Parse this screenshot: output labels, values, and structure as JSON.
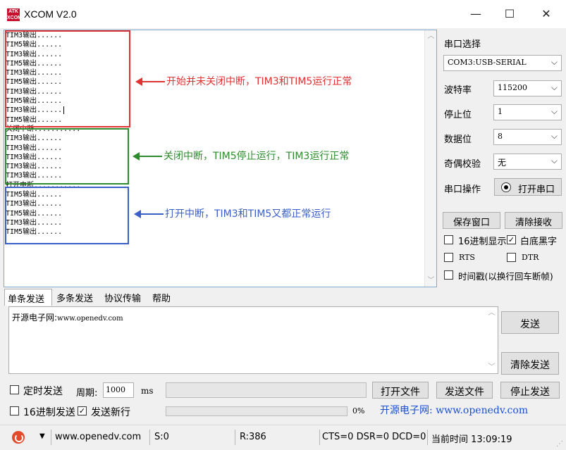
{
  "window": {
    "title": "XCOM V2.0",
    "logo_text": "ATK XCOM",
    "minimize_glyph": "—",
    "maximize_glyph": "☐",
    "close_glyph": "✕"
  },
  "receive": {
    "lines": [
      "TIM3输出......",
      "TIM5输出......",
      "TIM3输出......",
      "TIM5输出......",
      "TIM3输出......",
      "TIM5输出......",
      "TIM3输出......",
      "TIM5输出......",
      "TIM3输出......",
      "TIM5输出......",
      "关闭中断...........",
      "TIM3输出......",
      "TIM3输出......",
      "TIM3输出......",
      "TIM3输出......",
      "TIM3输出......",
      "打开中断...........",
      "TIM5输出......",
      "TIM3输出......",
      "TIM5输出......",
      "TIM3输出......",
      "TIM5输出......"
    ],
    "annotations": {
      "red": "开始并未关闭中断，TIM3和TIM5运行正常",
      "green": "关闭中断，TIM5停止运行，TIM3运行正常",
      "blue": "打开中断，TIM3和TIM5又都正常运行"
    },
    "colors": {
      "red": "#e03232",
      "green": "#2e8b2e",
      "blue": "#3a5fc8"
    }
  },
  "settings": {
    "port_select_label": "串口选择",
    "port_value": "COM3:USB-SERIAL",
    "baud_label": "波特率",
    "baud_value": "115200",
    "stop_bits_label": "停止位",
    "stop_bits_value": "1",
    "data_bits_label": "数据位",
    "data_bits_value": "8",
    "parity_label": "奇偶校验",
    "parity_value": "无",
    "port_op_label": "串口操作",
    "open_port_button": "打开串口",
    "save_window_button": "保存窗口",
    "clear_receive_button": "清除接收",
    "hex_display_label": "16进制显示",
    "hex_display_checked": false,
    "white_bg_label": "白底黑字",
    "white_bg_checked": true,
    "rts_label": "RTS",
    "dtr_label": "DTR",
    "timestamp_label": "时间戳(以换行回车断帧)"
  },
  "tabs": [
    {
      "label": "单条发送",
      "active": true
    },
    {
      "label": "多条发送",
      "active": false
    },
    {
      "label": "协议传输",
      "active": false
    },
    {
      "label": "帮助",
      "active": false
    }
  ],
  "send": {
    "text_prefix": "开源电子网:",
    "text_url": "www.openedv.com",
    "send_button": "发送",
    "clear_send_button": "清除发送",
    "timed_send_label": "定时发送",
    "period_label": "周期:",
    "period_value": "1000",
    "period_unit": "ms",
    "open_file_button": "打开文件",
    "send_file_button": "发送文件",
    "stop_send_button": "停止发送",
    "hex_send_label": "16进制发送",
    "newline_label": "发送新行",
    "newline_checked": true,
    "progress_percent": "0%",
    "website_banner": "开源电子网: www.openedv.com"
  },
  "status": {
    "site": "www.openedv.com",
    "sent": "S:0",
    "received": "R:386",
    "signals": "CTS=0 DSR=0 DCD=0",
    "time": "当前时间 13:09:19"
  }
}
